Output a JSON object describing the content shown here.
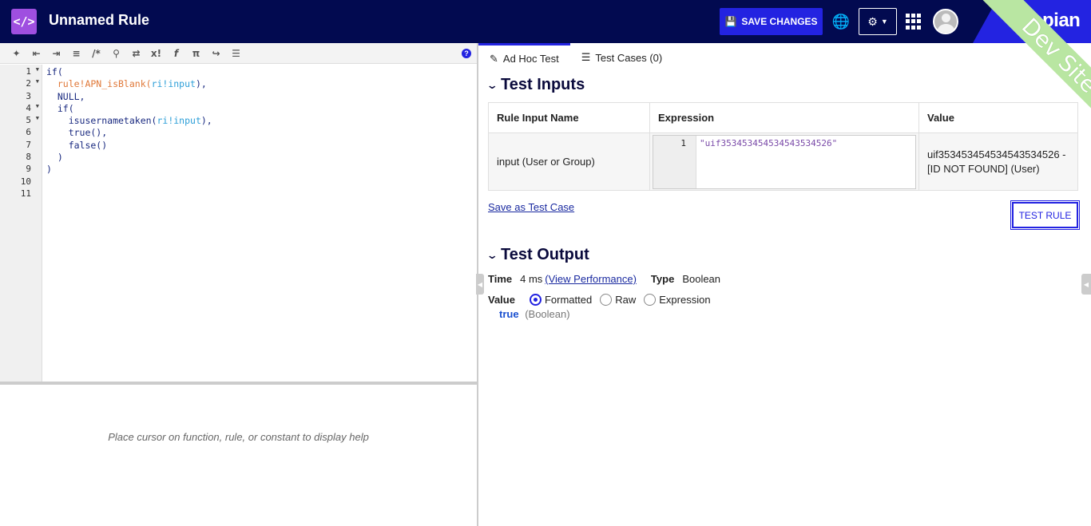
{
  "header": {
    "title": "Unnamed Rule",
    "save_label": "SAVE CHANGES",
    "brand": "appian",
    "ribbon": "Dev Site"
  },
  "editor": {
    "line_numbers": [
      "1",
      "2",
      "3",
      "4",
      "5",
      "6",
      "7",
      "8",
      "9",
      "10",
      "11"
    ],
    "help_text": "Place cursor on function, rule, or constant to display help"
  },
  "tabs": [
    {
      "label": "Ad Hoc Test"
    },
    {
      "label": "Test Cases (0)"
    }
  ],
  "test_inputs": {
    "title": "Test Inputs",
    "headers": [
      "Rule Input Name",
      "Expression",
      "Value"
    ],
    "row": {
      "name": "input (User or Group)",
      "expr_line": "1",
      "expression": "\"uif353453454534543534526\"",
      "value": "uif353453454534543534526 - [ID NOT FOUND] (User)"
    },
    "save_link": "Save as Test Case",
    "test_button": "TEST RULE"
  },
  "test_output": {
    "title": "Test Output",
    "time_label": "Time",
    "time_value": "4 ms",
    "perf_link": "(View Performance)",
    "type_label": "Type",
    "type_value": "Boolean",
    "value_label": "Value",
    "options": [
      "Formatted",
      "Raw",
      "Expression"
    ],
    "result": "true",
    "result_type": "(Boolean)"
  }
}
